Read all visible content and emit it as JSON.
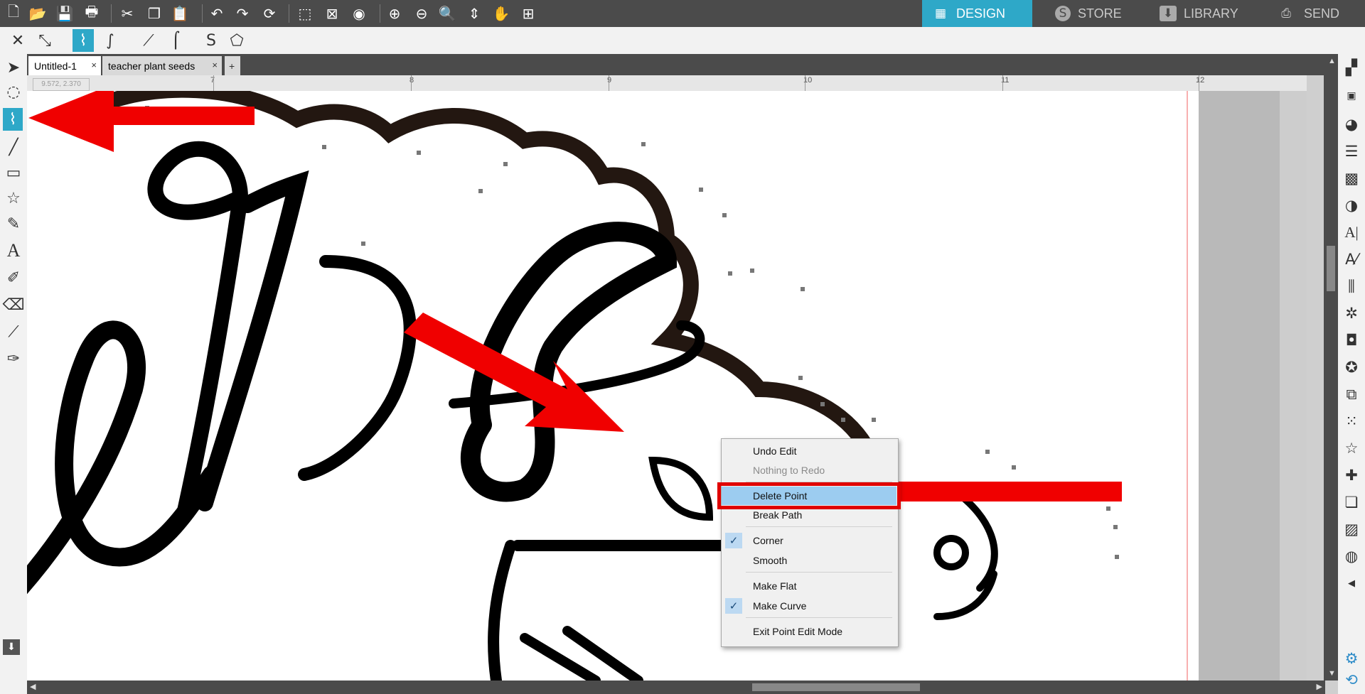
{
  "top_nav": {
    "tabs": [
      {
        "label": "DESIGN",
        "icon": "grid-icon",
        "active": true
      },
      {
        "label": "STORE",
        "icon": "store-icon",
        "active": false
      },
      {
        "label": "LIBRARY",
        "icon": "library-icon",
        "active": false
      },
      {
        "label": "SEND",
        "icon": "send-icon",
        "active": false
      }
    ]
  },
  "toolbar": {
    "icons": [
      "new-icon",
      "open-icon",
      "save-icon",
      "print-icon",
      "cut-icon",
      "copy-icon",
      "paste-icon",
      "undo-icon",
      "redo-icon",
      "refresh-icon",
      "select-all-icon",
      "deselect-icon",
      "select-color-icon",
      "zoom-in-icon",
      "zoom-out-icon",
      "zoom-select-icon",
      "drag-icon",
      "pan-icon",
      "fit-page-icon"
    ]
  },
  "point_toolbar": {
    "icons": [
      "delete-point-icon",
      "break-path-icon",
      "curve-point-icon",
      "smooth-point-icon",
      "make-flat-icon",
      "make-curve-icon",
      "s-curve-icon",
      "polygon-icon"
    ]
  },
  "doc_tabs": [
    {
      "label": "Untitled-1",
      "close": "×"
    },
    {
      "label": "teacher plant seeds",
      "close": "×"
    },
    {
      "label": "+",
      "close": ""
    }
  ],
  "ruler": {
    "labels": [
      "7",
      "8",
      "9",
      "10",
      "11",
      "12"
    ],
    "coordinates": "9.572, 2.370"
  },
  "canvas": {
    "text": "ers"
  },
  "context_menu": {
    "items": [
      {
        "label": "Undo Edit",
        "disabled": false,
        "checked": false,
        "highlighted": false
      },
      {
        "label": "Nothing to Redo",
        "disabled": true,
        "checked": false,
        "highlighted": false
      },
      {
        "label": "Delete Point",
        "disabled": false,
        "checked": false,
        "highlighted": true
      },
      {
        "label": "Break Path",
        "disabled": false,
        "checked": false,
        "highlighted": false
      },
      {
        "label": "Corner",
        "disabled": false,
        "checked": true,
        "highlighted": false
      },
      {
        "label": "Smooth",
        "disabled": false,
        "checked": false,
        "highlighted": false
      },
      {
        "label": "Make Flat",
        "disabled": false,
        "checked": false,
        "highlighted": false
      },
      {
        "label": "Make Curve",
        "disabled": false,
        "checked": true,
        "highlighted": false
      },
      {
        "label": "Exit Point Edit Mode",
        "disabled": false,
        "checked": false,
        "highlighted": false
      }
    ],
    "check_mark": "✓"
  },
  "colors": {
    "accent": "#2ea8c8",
    "annotation": "#f00000",
    "menu_highlight": "#9cccf0",
    "outline": "#231711"
  }
}
